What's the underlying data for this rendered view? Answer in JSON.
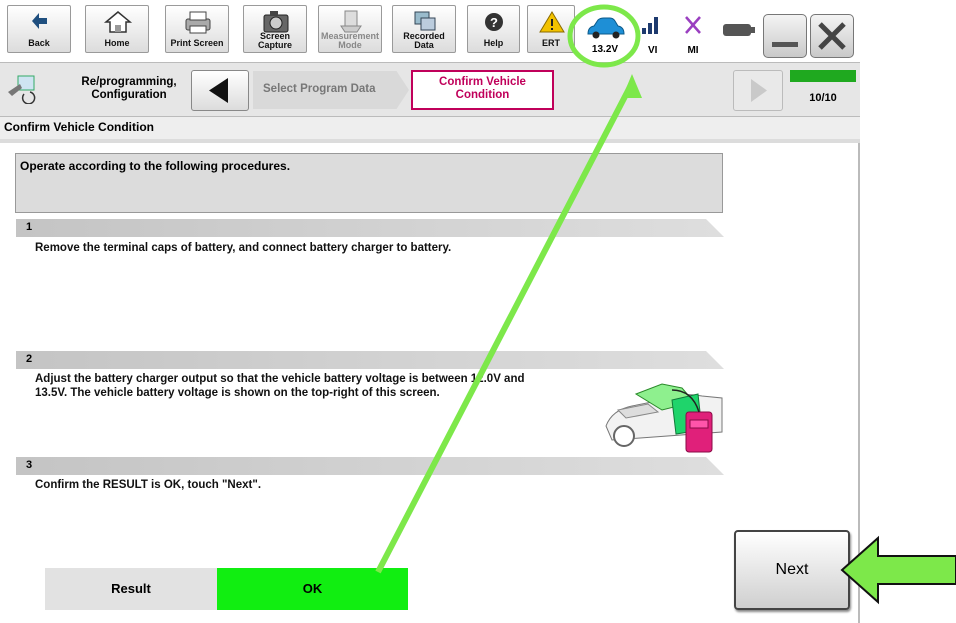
{
  "toolbar": {
    "back": "Back",
    "home": "Home",
    "print_screen": "Print Screen",
    "screen_capture": "Screen Capture",
    "measurement_mode": "Measurement Mode",
    "recorded_data": "Recorded Data",
    "help": "Help",
    "ert": "ERT",
    "voltage": "13.2V",
    "vi": "VI",
    "mi": "MI"
  },
  "breadcrumb": {
    "section": "Re/programming, Configuration",
    "step_prev": "Select Program Data",
    "step_current": "Confirm Vehicle Condition",
    "progress": "10/10",
    "progress_fraction": 1.0
  },
  "page_title": "Confirm Vehicle Condition",
  "instructions_header": "Operate according to the following procedures.",
  "steps": [
    {
      "num": "1",
      "text": "Remove the terminal caps of battery, and connect battery charger to battery."
    },
    {
      "num": "2",
      "text_line1": "Adjust the battery charger output so that the vehicle battery voltage is between 12.0V and",
      "text_line2": "13.5V. The vehicle battery voltage is shown on the top-right of this screen."
    },
    {
      "num": "3",
      "text": "Confirm the RESULT is OK, touch \"Next\"."
    }
  ],
  "result": {
    "label": "Result",
    "value": "OK"
  },
  "next_button": "Next",
  "colors": {
    "ok_green": "#11ee11",
    "annotation_green": "#7de84a",
    "current_step_border": "#c0005a"
  }
}
